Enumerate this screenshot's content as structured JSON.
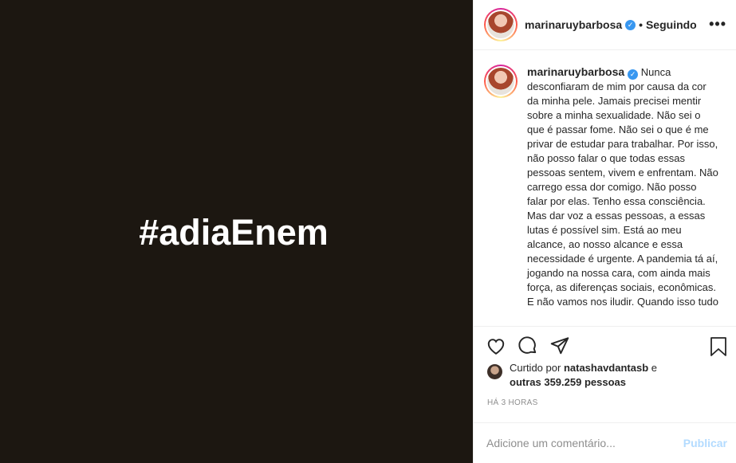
{
  "media": {
    "text": "#adiaEnem"
  },
  "header": {
    "username": "marinaruybarbosa",
    "follow_status": "• Seguindo",
    "more": "•••"
  },
  "caption": {
    "username": "marinaruybarbosa",
    "text": "Nunca desconfiaram de mim por causa da cor da minha pele. Jamais precisei mentir sobre a minha sexualidade. Não sei o que é passar fome. Não sei o que é me privar de estudar para trabalhar. Por isso, não posso falar o que todas essas pessoas sentem, vivem e enfrentam. Não carrego essa dor comigo. Não posso falar por elas. Tenho essa consciência. Mas dar voz a essas pessoas, a essas lutas é possível sim. Está ao meu alcance, ao nosso alcance e essa necessidade é urgente. A pandemia tá aí, jogando na nossa cara, com ainda mais força, as diferenças sociais, econômicas. E não vamos nos iludir. Quando isso tudo"
  },
  "likes": {
    "prefix": "Curtido por",
    "user": "natashavdantasb",
    "mid": "e",
    "others": "outras 359.259 pessoas"
  },
  "time": "HÁ 3 HORAS",
  "comment": {
    "placeholder": "Adicione um comentário...",
    "publish": "Publicar"
  },
  "icons": [
    "heart-icon",
    "comment-icon",
    "share-icon",
    "bookmark-icon",
    "verified-icon",
    "more-icon"
  ]
}
